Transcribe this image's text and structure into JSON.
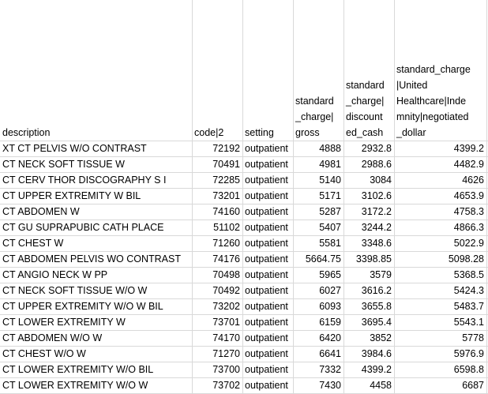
{
  "headers": {
    "description": "description",
    "code": "code|2",
    "setting": "setting",
    "gross": "standard\n_charge|\ngross",
    "discounted_cash": "standard\n_charge|\ndiscount\ned_cash",
    "negotiated": "standard_charge\n|United\nHealthcare|Inde\nmnity|negotiated\n_dollar"
  },
  "rows": [
    {
      "description": "XT CT PELVIS W/O CONTRAST",
      "code": "72192",
      "setting": "outpatient",
      "gross": "4888",
      "discounted_cash": "2932.8",
      "negotiated": "4399.2"
    },
    {
      "description": "CT NECK SOFT TISSUE W",
      "code": "70491",
      "setting": "outpatient",
      "gross": "4981",
      "discounted_cash": "2988.6",
      "negotiated": "4482.9"
    },
    {
      "description": "CT CERV THOR DISCOGRAPHY S I",
      "code": "72285",
      "setting": "outpatient",
      "gross": "5140",
      "discounted_cash": "3084",
      "negotiated": "4626"
    },
    {
      "description": "CT UPPER EXTREMITY W BIL",
      "code": "73201",
      "setting": "outpatient",
      "gross": "5171",
      "discounted_cash": "3102.6",
      "negotiated": "4653.9"
    },
    {
      "description": "CT ABDOMEN W",
      "code": "74160",
      "setting": "outpatient",
      "gross": "5287",
      "discounted_cash": "3172.2",
      "negotiated": "4758.3"
    },
    {
      "description": "CT GU SUPRAPUBIC CATH PLACE",
      "code": "51102",
      "setting": "outpatient",
      "gross": "5407",
      "discounted_cash": "3244.2",
      "negotiated": "4866.3"
    },
    {
      "description": "CT CHEST W",
      "code": "71260",
      "setting": "outpatient",
      "gross": "5581",
      "discounted_cash": "3348.6",
      "negotiated": "5022.9"
    },
    {
      "description": "CT ABDOMEN PELVIS WO CONTRAST",
      "code": "74176",
      "setting": "outpatient",
      "gross": "5664.75",
      "discounted_cash": "3398.85",
      "negotiated": "5098.28"
    },
    {
      "description": "CT ANGIO NECK W PP",
      "code": "70498",
      "setting": "outpatient",
      "gross": "5965",
      "discounted_cash": "3579",
      "negotiated": "5368.5"
    },
    {
      "description": "CT NECK SOFT TISSUE W/O W",
      "code": "70492",
      "setting": "outpatient",
      "gross": "6027",
      "discounted_cash": "3616.2",
      "negotiated": "5424.3"
    },
    {
      "description": "CT UPPER EXTREMITY W/O W BIL",
      "code": "73202",
      "setting": "outpatient",
      "gross": "6093",
      "discounted_cash": "3655.8",
      "negotiated": "5483.7"
    },
    {
      "description": "CT LOWER EXTREMITY W",
      "code": "73701",
      "setting": "outpatient",
      "gross": "6159",
      "discounted_cash": "3695.4",
      "negotiated": "5543.1"
    },
    {
      "description": "CT ABDOMEN W/O W",
      "code": "74170",
      "setting": "outpatient",
      "gross": "6420",
      "discounted_cash": "3852",
      "negotiated": "5778"
    },
    {
      "description": "CT CHEST W/O W",
      "code": "71270",
      "setting": "outpatient",
      "gross": "6641",
      "discounted_cash": "3984.6",
      "negotiated": "5976.9"
    },
    {
      "description": "CT LOWER EXTREMITY W/O BIL",
      "code": "73700",
      "setting": "outpatient",
      "gross": "7332",
      "discounted_cash": "4399.2",
      "negotiated": "6598.8"
    },
    {
      "description": "CT LOWER EXTREMITY W/O W",
      "code": "73702",
      "setting": "outpatient",
      "gross": "7430",
      "discounted_cash": "4458",
      "negotiated": "6687"
    }
  ]
}
